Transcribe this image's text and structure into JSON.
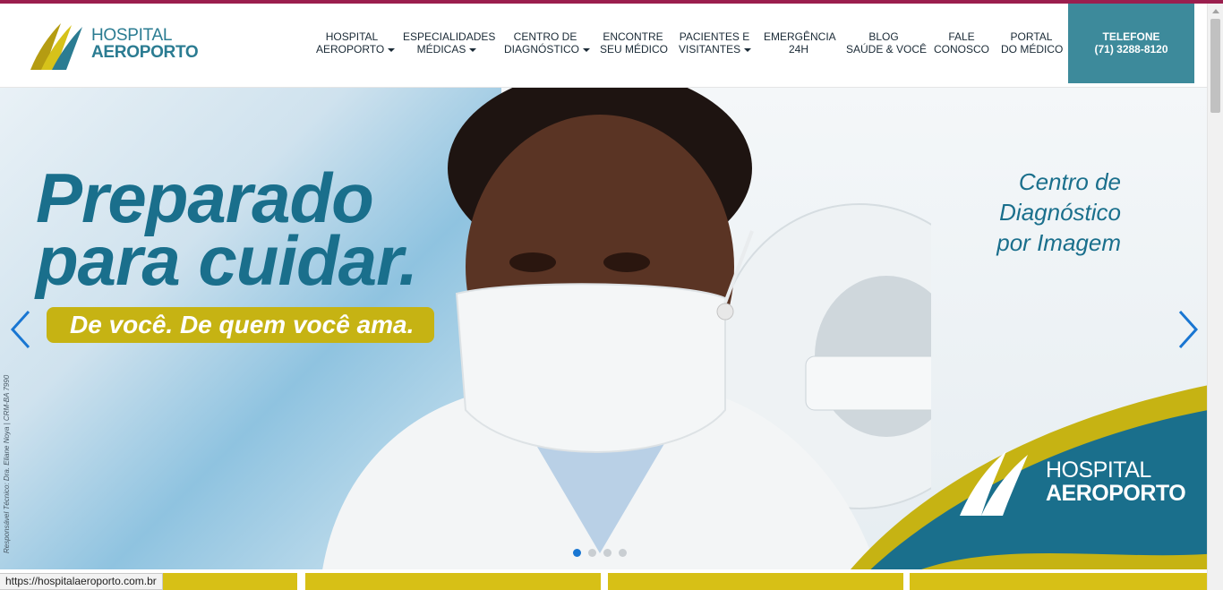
{
  "header": {
    "logo": {
      "line1": "HOSPITAL",
      "line2": "AEROPORTO"
    },
    "nav": [
      {
        "line1": "HOSPITAL",
        "line2": "AEROPORTO",
        "dropdown": true
      },
      {
        "line1": "ESPECIALIDADES",
        "line2": "MÉDICAS",
        "dropdown": true
      },
      {
        "line1": "CENTRO DE",
        "line2": "DIAGNÓSTICO",
        "dropdown": true
      },
      {
        "line1": "ENCONTRE",
        "line2": "SEU MÉDICO",
        "dropdown": false
      },
      {
        "line1": "PACIENTES E",
        "line2": "VISITANTES",
        "dropdown": true
      },
      {
        "line1": "EMERGÊNCIA",
        "line2": "24H",
        "dropdown": false
      },
      {
        "line1": "BLOG",
        "line2": "SAÚDE & VOCÊ",
        "dropdown": false
      },
      {
        "line1": "FALE",
        "line2": "CONOSCO",
        "dropdown": false
      },
      {
        "line1": "PORTAL",
        "line2": "DO MÉDICO",
        "dropdown": false
      }
    ],
    "phone": {
      "label": "TELEFONE",
      "number": "(71) 3288-8120"
    }
  },
  "banner": {
    "headline_line1": "Preparado",
    "headline_line2": "para cuidar.",
    "tagline": "De você. De quem você ama.",
    "centro_line1": "Centro de",
    "centro_line2": "Diagnóstico",
    "centro_line3": "por Imagem",
    "responsible": "Responsável Técnico: Dra. Eliane Noya | CRM-BA 7990",
    "brand": {
      "line1": "HOSPITAL",
      "line2": "AEROPORTO"
    },
    "slides_count": 4,
    "active_slide": 1
  },
  "status_url": "https://hospitalaeroporto.com.br",
  "colors": {
    "brand_teal": "#1a6f8c",
    "phone_bg": "#3d8a9b",
    "accent_yellow": "#c6b313",
    "topbar": "#9b1f4e"
  }
}
